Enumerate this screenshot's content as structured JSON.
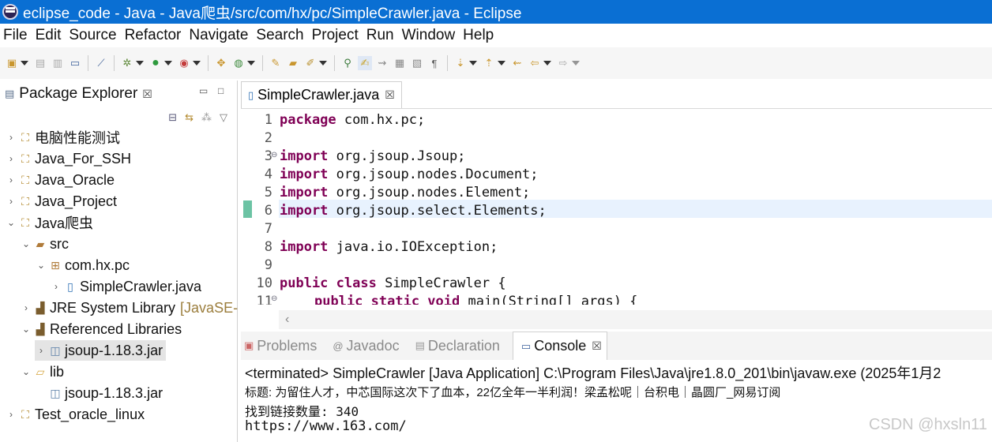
{
  "window": {
    "title": "eclipse_code - Java - Java爬虫/src/com/hx/pc/SimpleCrawler.java - Eclipse"
  },
  "menu": [
    "File",
    "Edit",
    "Source",
    "Refactor",
    "Navigate",
    "Search",
    "Project",
    "Run",
    "Window",
    "Help"
  ],
  "explorer": {
    "tab_label": "Package Explorer",
    "items": [
      {
        "label": "电脑性能测试",
        "icon": "project-icon"
      },
      {
        "label": "Java_For_SSH",
        "icon": "project-icon"
      },
      {
        "label": "Java_Oracle",
        "icon": "project-icon"
      },
      {
        "label": "Java_Project",
        "icon": "project-icon"
      },
      {
        "label": "Java爬虫",
        "icon": "project-icon"
      },
      {
        "label": "src",
        "icon": "source-folder-icon"
      },
      {
        "label": "com.hx.pc",
        "icon": "package-icon"
      },
      {
        "label": "SimpleCrawler.java",
        "icon": "java-file-icon"
      },
      {
        "label": "JRE System Library",
        "suffix": "[JavaSE-",
        "icon": "library-icon"
      },
      {
        "label": "Referenced Libraries",
        "icon": "library-icon"
      },
      {
        "label": "jsoup-1.18.3.jar",
        "icon": "jar-icon"
      },
      {
        "label": "lib",
        "icon": "folder-icon"
      },
      {
        "label": "jsoup-1.18.3.jar",
        "icon": "jar-icon"
      },
      {
        "label": "Test_oracle_linux",
        "icon": "project-icon"
      }
    ]
  },
  "editor": {
    "tab_label": "SimpleCrawler.java",
    "lines": [
      {
        "n": "1",
        "kw": "package",
        "rest": " com.hx.pc;"
      },
      {
        "n": "2",
        "kw": "",
        "rest": ""
      },
      {
        "n": "3",
        "kw": "import",
        "rest": " org.jsoup.Jsoup;"
      },
      {
        "n": "4",
        "kw": "import",
        "rest": " org.jsoup.nodes.Document;"
      },
      {
        "n": "5",
        "kw": "import",
        "rest": " org.jsoup.nodes.Element;"
      },
      {
        "n": "6",
        "kw": "import",
        "rest": " org.jsoup.select.Elements;"
      },
      {
        "n": "7",
        "kw": "",
        "rest": ""
      },
      {
        "n": "8",
        "kw": "import",
        "rest": " java.io.IOException;"
      },
      {
        "n": "9",
        "kw": "",
        "rest": ""
      },
      {
        "n": "10",
        "kw": "public class",
        "rest": " SimpleCrawler {"
      },
      {
        "n": "11",
        "kw": "public static void",
        "rest": " main(String[] args) {"
      }
    ]
  },
  "console": {
    "tabs": [
      "Problems",
      "Javadoc",
      "Declaration",
      "Console"
    ],
    "terminated": "<terminated> SimpleCrawler [Java Application] C:\\Program Files\\Java\\jre1.8.0_201\\bin\\javaw.exe  (2025年1月2",
    "line1": "标题: 为留住人才，中芯国际这次下了血本，22亿全年一半利润！梁孟松呢｜台积电｜晶圆厂_网易订阅",
    "line2": "找到链接数量: 340",
    "line3": "https://www.163.com/"
  },
  "watermark": "CSDN @hxsln11"
}
